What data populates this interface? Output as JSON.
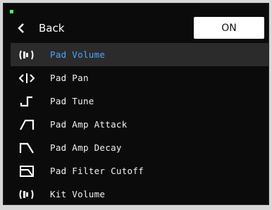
{
  "header": {
    "back_label": "Back",
    "toggle_label": "ON"
  },
  "colors": {
    "accent": "#4ea6ff",
    "background": "#0b0b0b",
    "selected_row": "#2b2b2b",
    "led": "#47ff62"
  },
  "menu": {
    "selected_index": 0,
    "items": [
      {
        "label": "Pad Volume",
        "icon": "volume-icon"
      },
      {
        "label": "Pad Pan",
        "icon": "pan-icon"
      },
      {
        "label": "Pad Tune",
        "icon": "tune-icon"
      },
      {
        "label": "Pad Amp Attack",
        "icon": "amp-attack-icon"
      },
      {
        "label": "Pad Amp Decay",
        "icon": "amp-decay-icon"
      },
      {
        "label": "Pad Filter Cutoff",
        "icon": "filter-cutoff-icon"
      },
      {
        "label": "Kit Volume",
        "icon": "volume-icon"
      }
    ]
  }
}
